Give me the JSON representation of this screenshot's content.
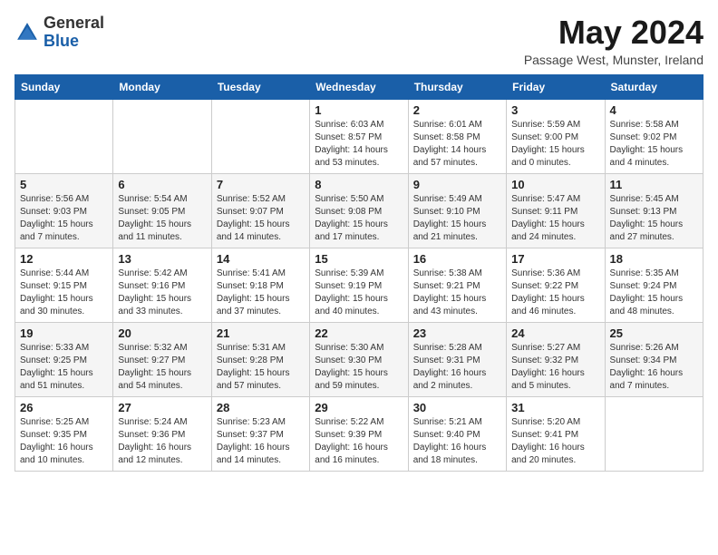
{
  "logo": {
    "general": "General",
    "blue": "Blue"
  },
  "title": "May 2024",
  "subtitle": "Passage West, Munster, Ireland",
  "weekdays": [
    "Sunday",
    "Monday",
    "Tuesday",
    "Wednesday",
    "Thursday",
    "Friday",
    "Saturday"
  ],
  "weeks": [
    [
      {
        "day": "",
        "info": ""
      },
      {
        "day": "",
        "info": ""
      },
      {
        "day": "",
        "info": ""
      },
      {
        "day": "1",
        "info": "Sunrise: 6:03 AM\nSunset: 8:57 PM\nDaylight: 14 hours\nand 53 minutes."
      },
      {
        "day": "2",
        "info": "Sunrise: 6:01 AM\nSunset: 8:58 PM\nDaylight: 14 hours\nand 57 minutes."
      },
      {
        "day": "3",
        "info": "Sunrise: 5:59 AM\nSunset: 9:00 PM\nDaylight: 15 hours\nand 0 minutes."
      },
      {
        "day": "4",
        "info": "Sunrise: 5:58 AM\nSunset: 9:02 PM\nDaylight: 15 hours\nand 4 minutes."
      }
    ],
    [
      {
        "day": "5",
        "info": "Sunrise: 5:56 AM\nSunset: 9:03 PM\nDaylight: 15 hours\nand 7 minutes."
      },
      {
        "day": "6",
        "info": "Sunrise: 5:54 AM\nSunset: 9:05 PM\nDaylight: 15 hours\nand 11 minutes."
      },
      {
        "day": "7",
        "info": "Sunrise: 5:52 AM\nSunset: 9:07 PM\nDaylight: 15 hours\nand 14 minutes."
      },
      {
        "day": "8",
        "info": "Sunrise: 5:50 AM\nSunset: 9:08 PM\nDaylight: 15 hours\nand 17 minutes."
      },
      {
        "day": "9",
        "info": "Sunrise: 5:49 AM\nSunset: 9:10 PM\nDaylight: 15 hours\nand 21 minutes."
      },
      {
        "day": "10",
        "info": "Sunrise: 5:47 AM\nSunset: 9:11 PM\nDaylight: 15 hours\nand 24 minutes."
      },
      {
        "day": "11",
        "info": "Sunrise: 5:45 AM\nSunset: 9:13 PM\nDaylight: 15 hours\nand 27 minutes."
      }
    ],
    [
      {
        "day": "12",
        "info": "Sunrise: 5:44 AM\nSunset: 9:15 PM\nDaylight: 15 hours\nand 30 minutes."
      },
      {
        "day": "13",
        "info": "Sunrise: 5:42 AM\nSunset: 9:16 PM\nDaylight: 15 hours\nand 33 minutes."
      },
      {
        "day": "14",
        "info": "Sunrise: 5:41 AM\nSunset: 9:18 PM\nDaylight: 15 hours\nand 37 minutes."
      },
      {
        "day": "15",
        "info": "Sunrise: 5:39 AM\nSunset: 9:19 PM\nDaylight: 15 hours\nand 40 minutes."
      },
      {
        "day": "16",
        "info": "Sunrise: 5:38 AM\nSunset: 9:21 PM\nDaylight: 15 hours\nand 43 minutes."
      },
      {
        "day": "17",
        "info": "Sunrise: 5:36 AM\nSunset: 9:22 PM\nDaylight: 15 hours\nand 46 minutes."
      },
      {
        "day": "18",
        "info": "Sunrise: 5:35 AM\nSunset: 9:24 PM\nDaylight: 15 hours\nand 48 minutes."
      }
    ],
    [
      {
        "day": "19",
        "info": "Sunrise: 5:33 AM\nSunset: 9:25 PM\nDaylight: 15 hours\nand 51 minutes."
      },
      {
        "day": "20",
        "info": "Sunrise: 5:32 AM\nSunset: 9:27 PM\nDaylight: 15 hours\nand 54 minutes."
      },
      {
        "day": "21",
        "info": "Sunrise: 5:31 AM\nSunset: 9:28 PM\nDaylight: 15 hours\nand 57 minutes."
      },
      {
        "day": "22",
        "info": "Sunrise: 5:30 AM\nSunset: 9:30 PM\nDaylight: 15 hours\nand 59 minutes."
      },
      {
        "day": "23",
        "info": "Sunrise: 5:28 AM\nSunset: 9:31 PM\nDaylight: 16 hours\nand 2 minutes."
      },
      {
        "day": "24",
        "info": "Sunrise: 5:27 AM\nSunset: 9:32 PM\nDaylight: 16 hours\nand 5 minutes."
      },
      {
        "day": "25",
        "info": "Sunrise: 5:26 AM\nSunset: 9:34 PM\nDaylight: 16 hours\nand 7 minutes."
      }
    ],
    [
      {
        "day": "26",
        "info": "Sunrise: 5:25 AM\nSunset: 9:35 PM\nDaylight: 16 hours\nand 10 minutes."
      },
      {
        "day": "27",
        "info": "Sunrise: 5:24 AM\nSunset: 9:36 PM\nDaylight: 16 hours\nand 12 minutes."
      },
      {
        "day": "28",
        "info": "Sunrise: 5:23 AM\nSunset: 9:37 PM\nDaylight: 16 hours\nand 14 minutes."
      },
      {
        "day": "29",
        "info": "Sunrise: 5:22 AM\nSunset: 9:39 PM\nDaylight: 16 hours\nand 16 minutes."
      },
      {
        "day": "30",
        "info": "Sunrise: 5:21 AM\nSunset: 9:40 PM\nDaylight: 16 hours\nand 18 minutes."
      },
      {
        "day": "31",
        "info": "Sunrise: 5:20 AM\nSunset: 9:41 PM\nDaylight: 16 hours\nand 20 minutes."
      },
      {
        "day": "",
        "info": ""
      }
    ]
  ]
}
